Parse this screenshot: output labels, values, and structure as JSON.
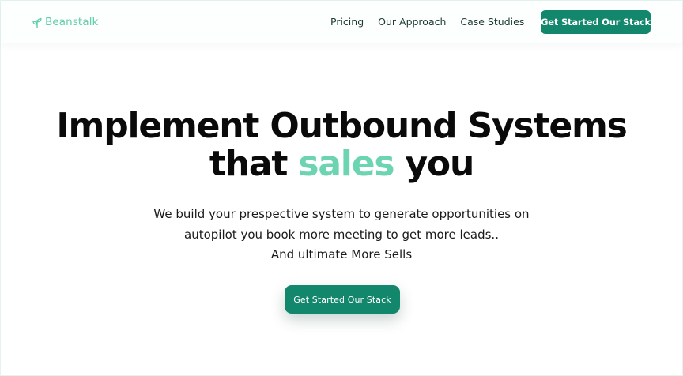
{
  "header": {
    "logo_text": "Beanstalk",
    "logo_icon": "sprout-icon",
    "nav": [
      "Pricing",
      "Our Approach",
      "Case Studies"
    ],
    "cta_label": "Get Started Our Stack"
  },
  "hero": {
    "title_line1": "Implement Outbound Systems",
    "title_line2_pre": "that",
    "title_line2_accent": "sales",
    "title_line2_post": "you",
    "subtitle_lines": [
      "We build your prespective system to generate opportunities on",
      "autopilot you book more meeting to get more leads..",
      "And ultimate More Sells"
    ],
    "cta_label": "Get Started Our Stack"
  },
  "colors": {
    "brand_green": "#13876b",
    "accent_mint": "#6dd4b1",
    "logo_mint": "#5fcfa9"
  }
}
